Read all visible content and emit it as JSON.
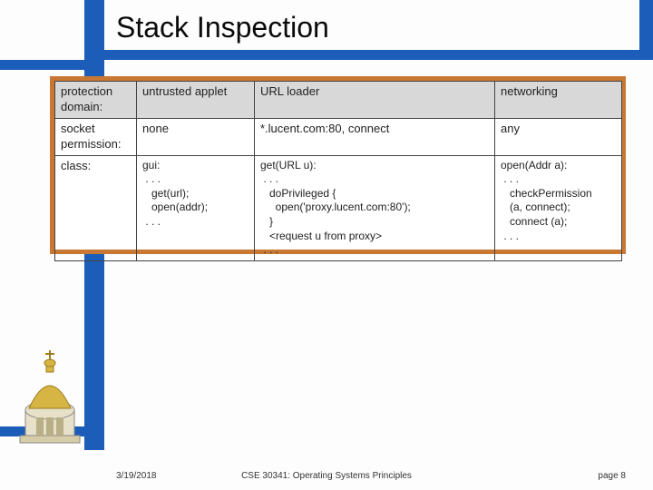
{
  "title": "Stack Inspection",
  "footer": {
    "date": "3/19/2018",
    "course": "CSE 30341: Operating Systems Principles",
    "page": "page 8"
  },
  "chart_data": {
    "type": "table",
    "columns": [
      "protection domain:",
      "untrusted applet",
      "URL loader",
      "networking"
    ],
    "rows": [
      {
        "label": "socket permission:",
        "cells": [
          "none",
          "*.lucent.com:80, connect",
          "any"
        ]
      },
      {
        "label": "class:",
        "cells": [
          "gui:\n . . .\n   get(url);\n   open(addr);\n . . .",
          "get(URL u):\n . . .\n   doPrivileged {\n     open('proxy.lucent.com:80');\n   }\n   <request u from proxy>\n . . .",
          "open(Addr a):\n . . .\n   checkPermission\n   (a, connect);\n   connect (a);\n . . ."
        ]
      }
    ]
  }
}
